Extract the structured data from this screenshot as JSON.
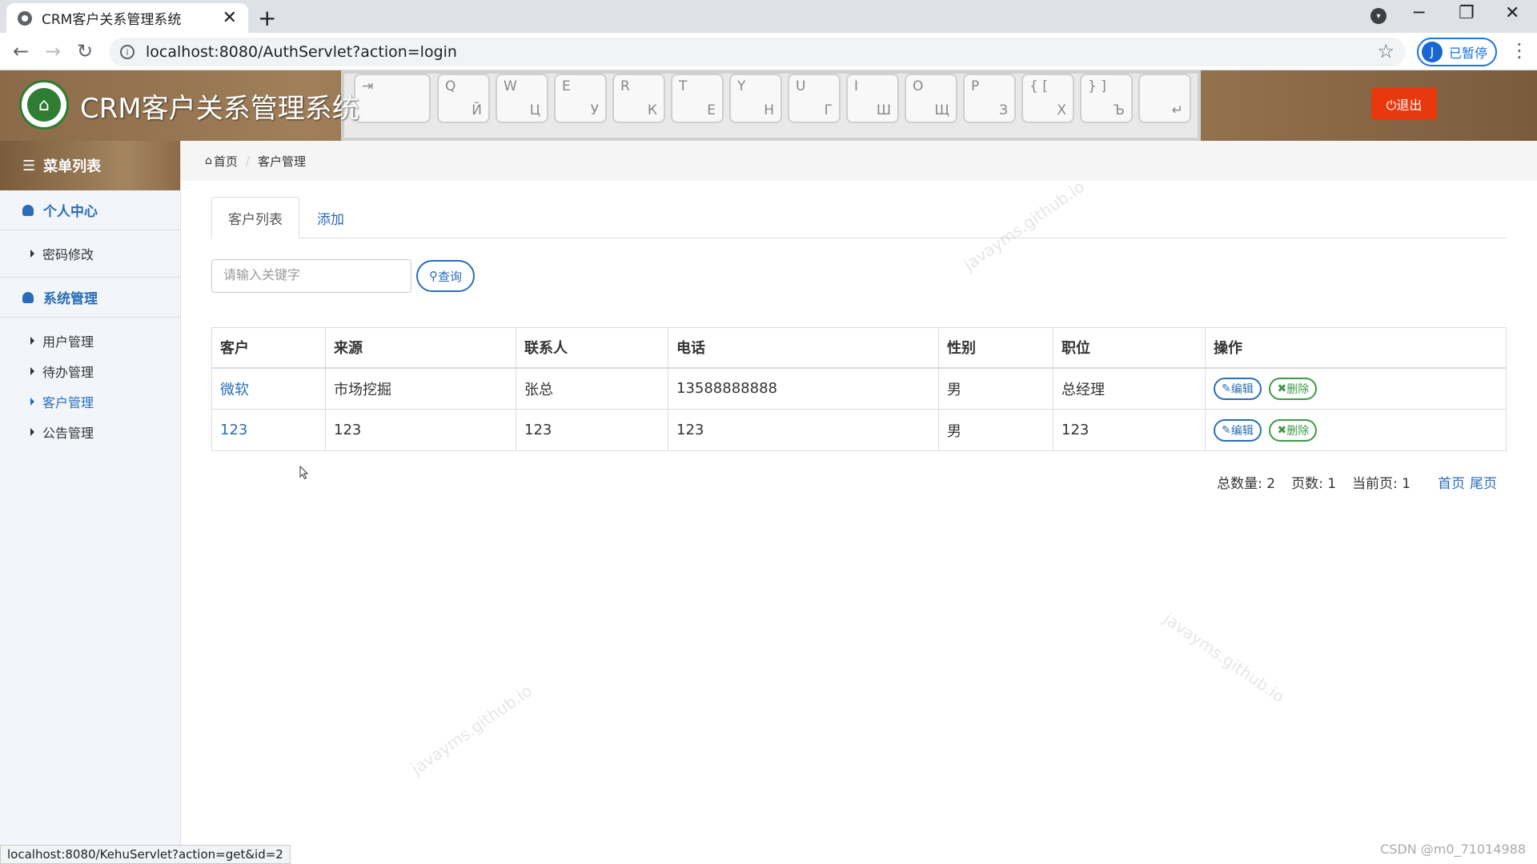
{
  "browser": {
    "tab_title": "CRM客户关系管理系统",
    "tab_close": "✕",
    "new_tab": "+",
    "url": "localhost:8080/AuthServlet?action=login",
    "profile_initial": "J",
    "profile_status": "已暂停",
    "status_url": "localhost:8080/KehuServlet?action=get&id=2"
  },
  "header": {
    "app_title": "CRM客户关系管理系统",
    "logout_label": "⏻退出",
    "keyboard_keys": [
      {
        "a": "⇥",
        "b": ""
      },
      {
        "a": "Q",
        "b": "Й"
      },
      {
        "a": "W",
        "b": "Ц"
      },
      {
        "a": "E",
        "b": "У"
      },
      {
        "a": "R",
        "b": "К"
      },
      {
        "a": "T",
        "b": "Е"
      },
      {
        "a": "Y",
        "b": "Н"
      },
      {
        "a": "U",
        "b": "Г"
      },
      {
        "a": "I",
        "b": "Ш"
      },
      {
        "a": "O",
        "b": "Щ"
      },
      {
        "a": "P",
        "b": "З"
      },
      {
        "a": "{ [",
        "b": "Х"
      },
      {
        "a": "} ]",
        "b": "Ъ"
      },
      {
        "a": "",
        "b": "↵"
      }
    ]
  },
  "sidebar": {
    "title": "菜单列表",
    "sections": [
      {
        "title": "个人中心",
        "items": [
          {
            "label": "密码修改",
            "active": false
          }
        ]
      },
      {
        "title": "系统管理",
        "items": [
          {
            "label": "用户管理",
            "active": false
          },
          {
            "label": "待办管理",
            "active": false
          },
          {
            "label": "客户管理",
            "active": true
          },
          {
            "label": "公告管理",
            "active": false
          }
        ]
      }
    ]
  },
  "breadcrumb": {
    "home": "首页",
    "current": "客户管理"
  },
  "tabs": {
    "list": "客户列表",
    "add": "添加"
  },
  "search": {
    "placeholder": "请输入关键字",
    "button": "查询"
  },
  "table": {
    "headers": [
      "客户",
      "来源",
      "联系人",
      "电话",
      "性别",
      "职位",
      "操作"
    ],
    "rows": [
      {
        "customer": "微软",
        "source": "市场挖掘",
        "contact": "张总",
        "phone": "13588888888",
        "gender": "男",
        "position": "总经理"
      },
      {
        "customer": "123",
        "source": "123",
        "contact": "123",
        "phone": "123",
        "gender": "男",
        "position": "123"
      }
    ],
    "edit_label": "编辑",
    "delete_label": "删除"
  },
  "pager": {
    "total": "总数量: 2",
    "pages": "页数: 1",
    "current": "当前页: 1",
    "first": "首页",
    "last": "尾页"
  },
  "watermark": "javayms.github.io",
  "csdn": "CSDN @m0_71014988"
}
